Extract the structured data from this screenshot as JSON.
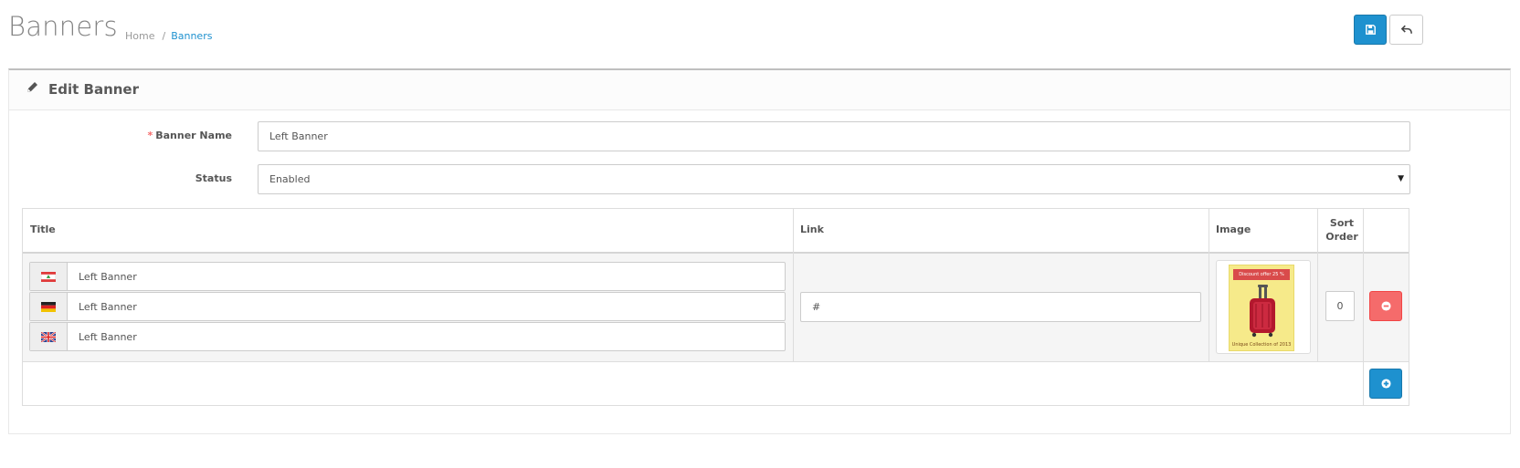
{
  "header": {
    "title": "Banners",
    "breadcrumb": [
      {
        "label": "Home"
      },
      {
        "label": "Banners"
      }
    ],
    "save_icon": "save-icon",
    "back_icon": "reply-icon"
  },
  "panel": {
    "title": "Edit Banner",
    "icon": "pencil-icon"
  },
  "form": {
    "banner_name_label": "Banner Name",
    "banner_name_required": "*",
    "banner_name_value": "Left Banner",
    "status_label": "Status",
    "status_value": "Enabled"
  },
  "table": {
    "headers": {
      "title": "Title",
      "link": "Link",
      "image": "Image",
      "sort_order": "Sort Order"
    },
    "rows": [
      {
        "titles": [
          {
            "flag": "lebanon-flag-icon",
            "value": "Left Banner"
          },
          {
            "flag": "germany-flag-icon",
            "value": "Left Banner"
          },
          {
            "flag": "uk-flag-icon",
            "value": "Left Banner"
          }
        ],
        "link": "#",
        "image": {
          "top_text": "Discount offer 25 %",
          "bottom_text": "Unique Collection of 2013"
        },
        "sort_order": "0"
      }
    ]
  },
  "colors": {
    "primary": "#1e91cf",
    "danger": "#f56b6b"
  }
}
